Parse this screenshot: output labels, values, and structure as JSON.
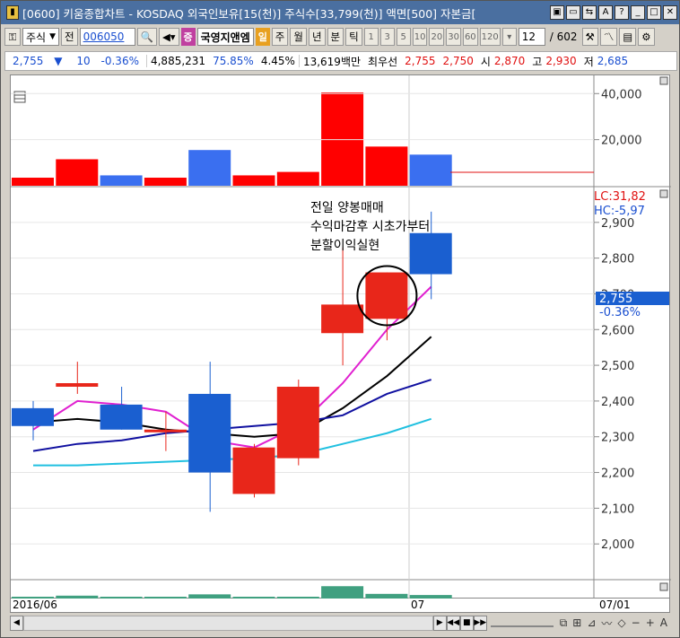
{
  "window": {
    "title": "[0600] 키움종합차트 - KOSDAQ 외국인보유[15(천)] 주식수[33,799(천)] 액면[500] 자본금[",
    "buttons": [
      "▣",
      "▭",
      "⇆",
      "A",
      "?",
      "_",
      "□",
      "✕"
    ]
  },
  "toolbar": {
    "market": "주식",
    "prev_label": "전",
    "code": "006050",
    "stock_name": "국영지앤엠",
    "badge_jeung": "증",
    "badge_il": "일",
    "periods": [
      "주",
      "월",
      "년",
      "분",
      "틱"
    ],
    "minute_options": [
      "1",
      "3",
      "5",
      "10",
      "20",
      "30",
      "60",
      "120"
    ],
    "count": "12",
    "total": "/ 602"
  },
  "info": {
    "price": "2,755",
    "change_arrow": "▼",
    "change": "10",
    "change_pct": "-0.36%",
    "volume": "4,885,231",
    "pct1": "75.85%",
    "pct2": "4.45%",
    "amount": "13,619백만",
    "best_label": "최우선",
    "best_ask": "2,755",
    "best_bid": "2,750",
    "open_label": "시",
    "open": "2,870",
    "high_label": "고",
    "high": "2,930",
    "low_label": "저",
    "low": "2,685"
  },
  "annotation": {
    "line1": "전일 양봉매매",
    "line2": "수익마감후 시초가부터",
    "line3": "분할이익실현"
  },
  "price_panel": {
    "lc_label": "LC:31,82",
    "hc_label": "HC:-5,97",
    "current_price": "2,755",
    "current_change": "-0.36%",
    "ticks": [
      "2,900",
      "2,800",
      "2,700",
      "2,600",
      "2,500",
      "2,400",
      "2,300",
      "2,200",
      "2,100",
      "2,000"
    ]
  },
  "volume_panel": {
    "ticks": [
      "40,000",
      "20,000"
    ]
  },
  "xaxis": {
    "labels": [
      "2016/06",
      "07",
      "07/01"
    ]
  },
  "colors": {
    "up": "#e8261a",
    "down": "#1a5fd0",
    "vol_up": "#ff0000",
    "vol_down": "#3a6ff0",
    "ma5": "#e020d0",
    "ma10": "#000000",
    "ma20": "#1010a0",
    "ma60": "#20c0e0"
  },
  "chart_data": {
    "type": "candlestick",
    "price_ylim": [
      1900,
      3000
    ],
    "volume_ylim": [
      0,
      44000
    ],
    "candles": [
      {
        "o": 2380,
        "h": 2400,
        "l": 2290,
        "c": 2330
      },
      {
        "o": 2440,
        "h": 2510,
        "l": 2420,
        "c": 2450
      },
      {
        "o": 2390,
        "h": 2440,
        "l": 2320,
        "c": 2320
      },
      {
        "o": 2320,
        "h": 2370,
        "l": 2260,
        "c": 2320
      },
      {
        "o": 2420,
        "h": 2510,
        "l": 2090,
        "c": 2200
      },
      {
        "o": 2140,
        "h": 2280,
        "l": 2130,
        "c": 2270
      },
      {
        "o": 2240,
        "h": 2460,
        "l": 2220,
        "c": 2440
      },
      {
        "o": 2590,
        "h": 2830,
        "l": 2500,
        "c": 2670
      },
      {
        "o": 2630,
        "h": 2760,
        "l": 2570,
        "c": 2760
      },
      {
        "o": 2870,
        "h": 2930,
        "l": 2685,
        "c": 2755
      }
    ],
    "volumes": [
      {
        "v": 3500,
        "up": true
      },
      {
        "v": 11500,
        "up": true
      },
      {
        "v": 4500,
        "up": false
      },
      {
        "v": 3500,
        "up": true
      },
      {
        "v": 15500,
        "up": false
      },
      {
        "v": 4500,
        "up": true
      },
      {
        "v": 6000,
        "up": true
      },
      {
        "v": 40500,
        "up": true
      },
      {
        "v": 17000,
        "up": true
      },
      {
        "v": 13500,
        "up": false
      }
    ],
    "ma_lines": [
      {
        "color": "ma5",
        "values": [
          2320,
          2400,
          2390,
          2370,
          2290,
          2270,
          2330,
          2450,
          2600,
          2720
        ]
      },
      {
        "color": "ma10",
        "values": [
          2340,
          2350,
          2340,
          2320,
          2310,
          2300,
          2310,
          2380,
          2470,
          2580
        ]
      },
      {
        "color": "ma20",
        "values": [
          2260,
          2280,
          2290,
          2310,
          2320,
          2330,
          2340,
          2360,
          2420,
          2460
        ]
      },
      {
        "color": "ma60",
        "values": [
          2220,
          2220,
          2225,
          2230,
          2235,
          2240,
          2250,
          2280,
          2310,
          2350
        ]
      }
    ]
  }
}
